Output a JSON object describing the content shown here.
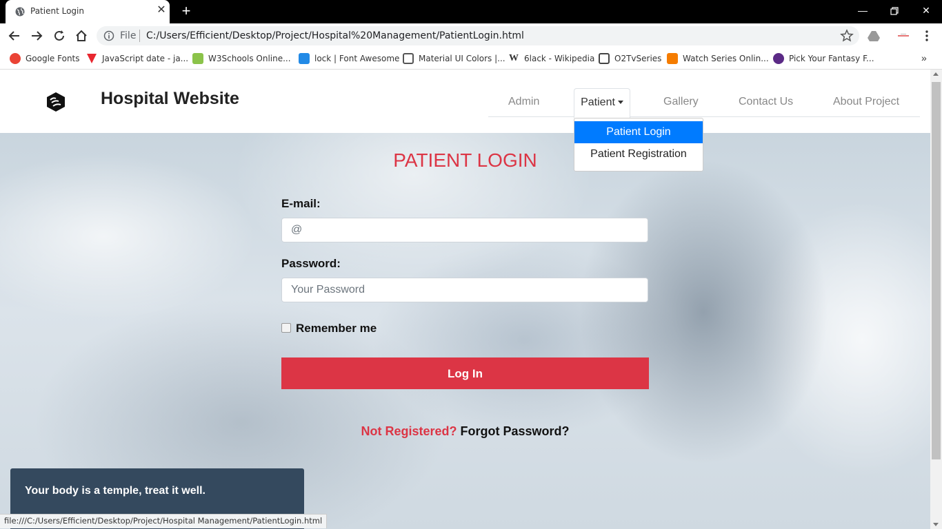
{
  "browser": {
    "tab_title": "Patient Login",
    "new_tab_symbol": "+",
    "address_scheme_label": "File",
    "address_url": "C:/Users/Efficient/Desktop/Project/Hospital%20Management/PatientLogin.html",
    "bookmarks": [
      {
        "label": "Google Fonts",
        "icon_color": "#ea4335",
        "icon": "fonts-icon"
      },
      {
        "label": "JavaScript date - ja...",
        "icon_color": "#e8272f",
        "icon": "vivaldi-icon"
      },
      {
        "label": "W3Schools Online...",
        "icon_color": "#8bc34a",
        "icon": "w3schools-icon"
      },
      {
        "label": "lock | Font Awesome",
        "icon_color": "#228ae6",
        "icon": "flag-icon"
      },
      {
        "label": "Material UI Colors |...",
        "icon_color": "#555555",
        "icon": "material-icon"
      },
      {
        "label": "6lack - Wikipedia",
        "icon_color": "#222222",
        "icon": "wikipedia-icon"
      },
      {
        "label": "O2TvSeries",
        "icon_color": "#444444",
        "icon": "o2tv-icon"
      },
      {
        "label": "Watch Series Onlin...",
        "icon_color": "#f57c00",
        "icon": "series-icon"
      },
      {
        "label": "Pick Your Fantasy F...",
        "icon_color": "#5b2a86",
        "icon": "premier-league-icon"
      }
    ],
    "more_symbol": "»",
    "status_url": "file:///C:/Users/Efficient/Desktop/Project/Hospital Management/PatientLogin.html"
  },
  "header": {
    "brand": "Hospital Website",
    "nav": [
      {
        "label": "Admin"
      },
      {
        "label": "Patient"
      },
      {
        "label": "Gallery"
      },
      {
        "label": "Contact Us"
      },
      {
        "label": "About Project"
      }
    ]
  },
  "dropdown": {
    "items": [
      {
        "label": "Patient Login",
        "active": true
      },
      {
        "label": "Patient Registration",
        "active": false
      }
    ]
  },
  "login": {
    "title": "PATIENT LOGIN",
    "email_label": "E-mail:",
    "email_placeholder": "@",
    "password_label": "Password:",
    "password_placeholder": "Your Password",
    "remember_label": "Remember me",
    "button_label": "Log In",
    "not_registered": "Not Registered?",
    "forgot_password": "Forgot Password?"
  },
  "quote": {
    "text": "Your body is a temple, treat it well."
  },
  "colors": {
    "accent": "#dc3545",
    "dropdown_active": "#007bff",
    "quote_bg": "#34495e"
  }
}
